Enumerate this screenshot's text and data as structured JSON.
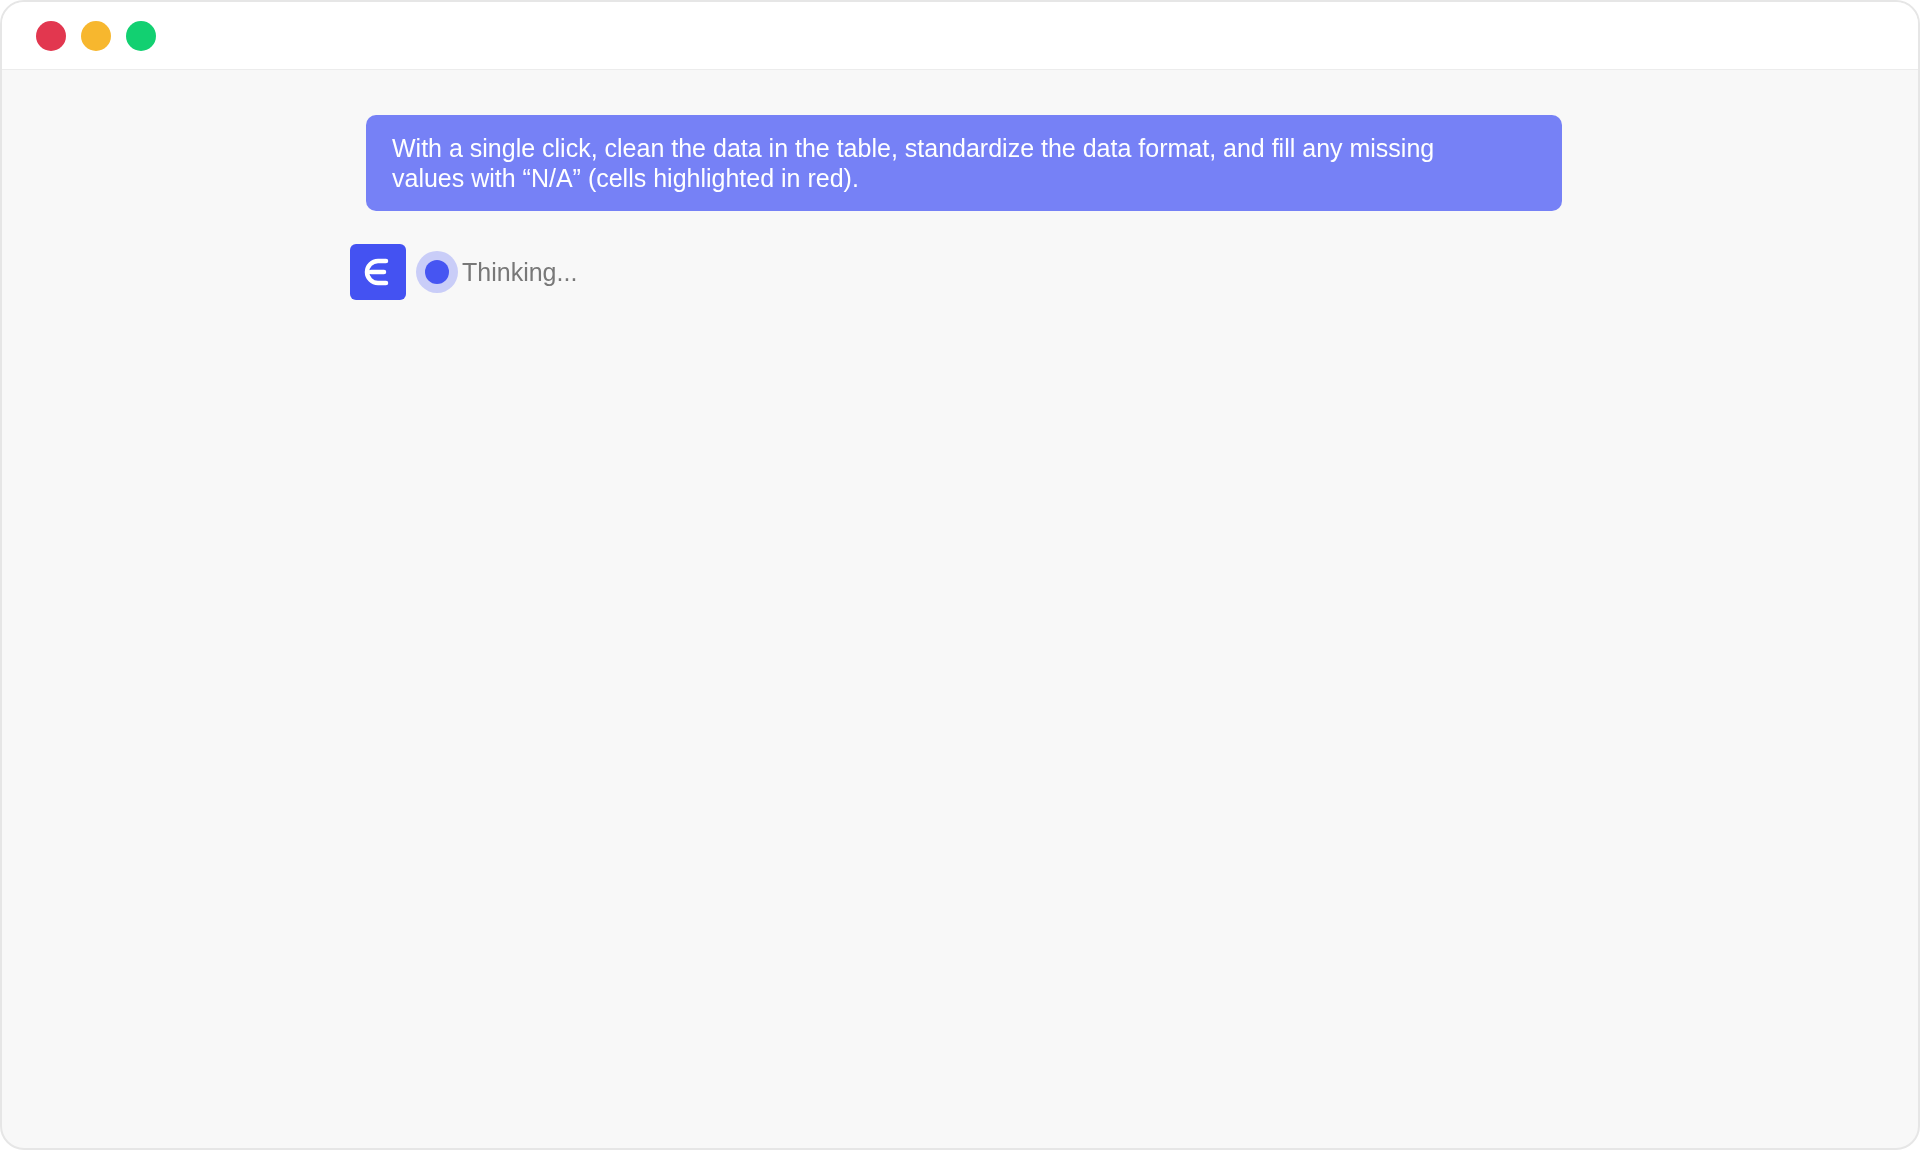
{
  "message": {
    "text": "With a single click, clean the data in the table, standardize the data format, and fill any missing values with “N/A” (cells highlighted in red)."
  },
  "assistant": {
    "status": "Thinking..."
  }
}
